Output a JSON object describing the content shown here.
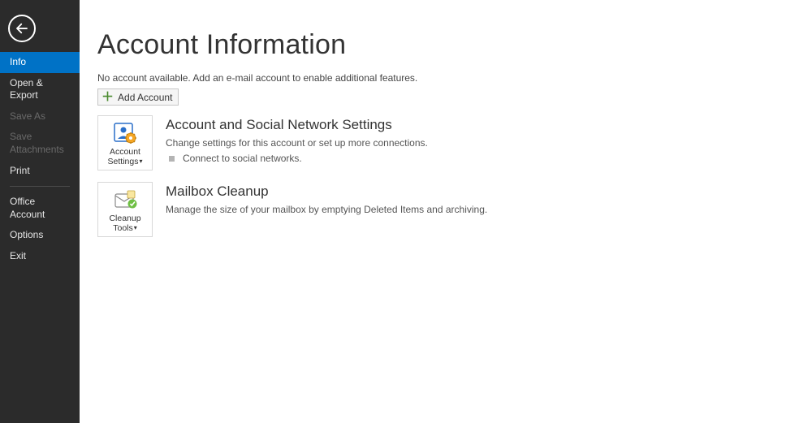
{
  "sidebar": {
    "items": [
      {
        "label": "Info"
      },
      {
        "label": "Open & Export"
      },
      {
        "label": "Save As"
      },
      {
        "label": "Save Attachments"
      },
      {
        "label": "Print"
      },
      {
        "label": "Office Account"
      },
      {
        "label": "Options"
      },
      {
        "label": "Exit"
      }
    ]
  },
  "main": {
    "title": "Account Information",
    "subtext": "No account available. Add an e-mail account to enable additional features.",
    "add_account_label": "Add Account"
  },
  "tiles": {
    "account_settings": {
      "line1": "Account",
      "line2": "Settings"
    },
    "cleanup_tools": {
      "line1": "Cleanup",
      "line2": "Tools"
    }
  },
  "sections": {
    "account": {
      "title": "Account and Social Network Settings",
      "desc": "Change settings for this account or set up more connections.",
      "bullet": "Connect to social networks."
    },
    "mailbox": {
      "title": "Mailbox Cleanup",
      "desc": "Manage the size of your mailbox by emptying Deleted Items and archiving."
    }
  }
}
